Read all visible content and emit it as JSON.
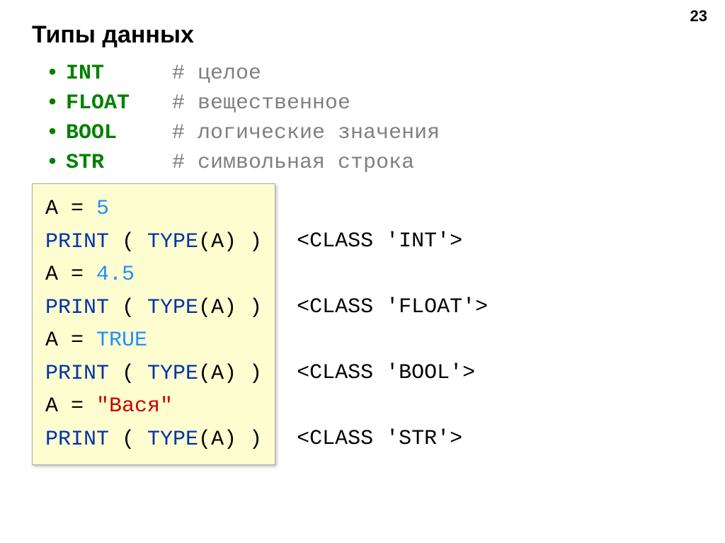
{
  "pageNumber": "23",
  "title": "Типы данных",
  "types": [
    {
      "name": "INT",
      "comment": "# целое"
    },
    {
      "name": "FLOAT",
      "comment": "# вещественное"
    },
    {
      "name": "BOOL",
      "comment": "# логические значения"
    },
    {
      "name": "STR",
      "comment": "# символьная строка"
    }
  ],
  "code": {
    "a": "A",
    "eq": " = ",
    "v1": "5",
    "v2": "4.5",
    "v3": "TRUE",
    "v4": "\"Вася\"",
    "print": "PRINT",
    "open": " ( ",
    "close": " )",
    "type": "TYPE",
    "typeArgOpen": "(",
    "typeArgClose": ")"
  },
  "output": {
    "l1": "<CLASS 'INT'>",
    "l2": "<CLASS 'FLOAT'>",
    "l3": "<CLASS 'BOOL'>",
    "l4": "<CLASS 'STR'>"
  }
}
